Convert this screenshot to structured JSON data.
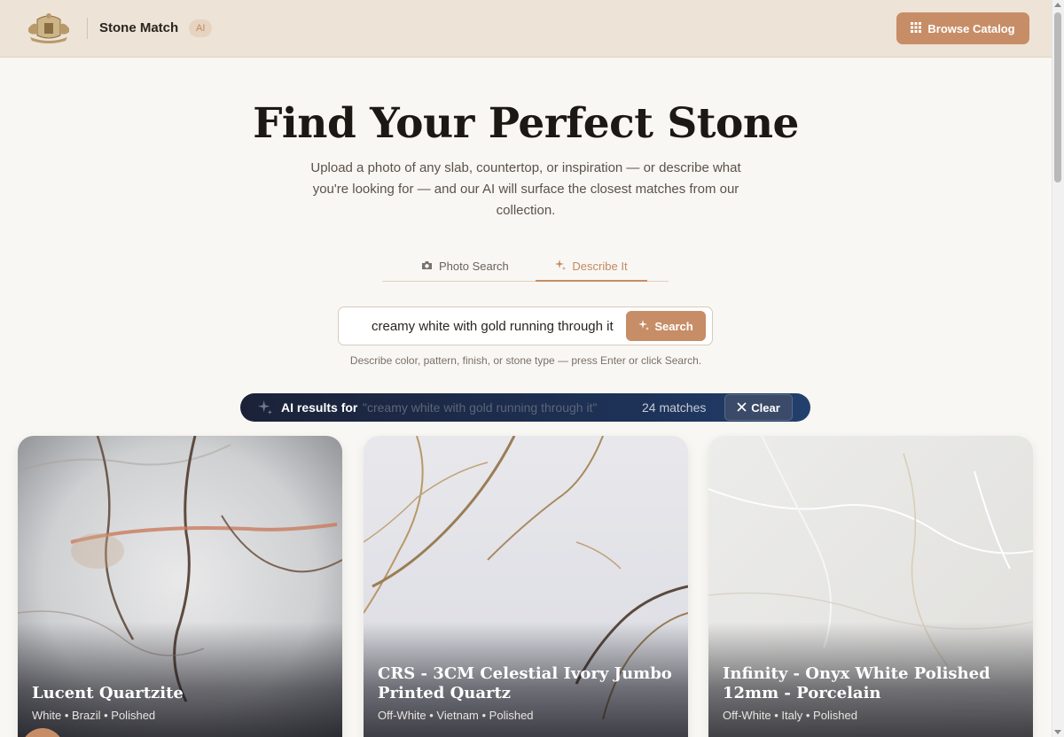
{
  "header": {
    "brand": "Stone Match",
    "badge": "AI",
    "browse_label": "Browse Catalog",
    "logo_icon": "crest-logo"
  },
  "hero": {
    "title": "Find Your Perfect Stone",
    "subtitle": "Upload a photo of any slab, countertop, or inspiration — or describe what you're looking for — and our AI will surface the closest matches from our collection."
  },
  "tabs": [
    {
      "label": "Photo Search",
      "icon": "camera-icon",
      "active": false
    },
    {
      "label": "Describe It",
      "icon": "sparkle-icon",
      "active": true
    }
  ],
  "search": {
    "value": "creamy white with gold running through it",
    "button_label": "Search",
    "hint": "Describe color, pattern, finish, or stone type — press Enter or click Search."
  },
  "results": {
    "label": "AI results for",
    "query": "\"creamy white with gold running through it\"",
    "count": "24 matches",
    "clear_label": "Clear"
  },
  "cards": [
    {
      "title": "Lucent Quartzite",
      "meta": "White • Brazil • Polished"
    },
    {
      "title": "CRS - 3CM Celestial Ivory Jumbo Printed Quartz",
      "meta": "Off-White • Vietnam • Polished"
    },
    {
      "title": "Infinity - Onyx White Polished 12mm - Porcelain",
      "meta": "Off-White • Italy • Polished"
    }
  ],
  "colors": {
    "accent": "#c78d67",
    "header_bg": "#ede3d6",
    "page_bg": "#f9f7f3",
    "results_bar": "#1e3258"
  }
}
